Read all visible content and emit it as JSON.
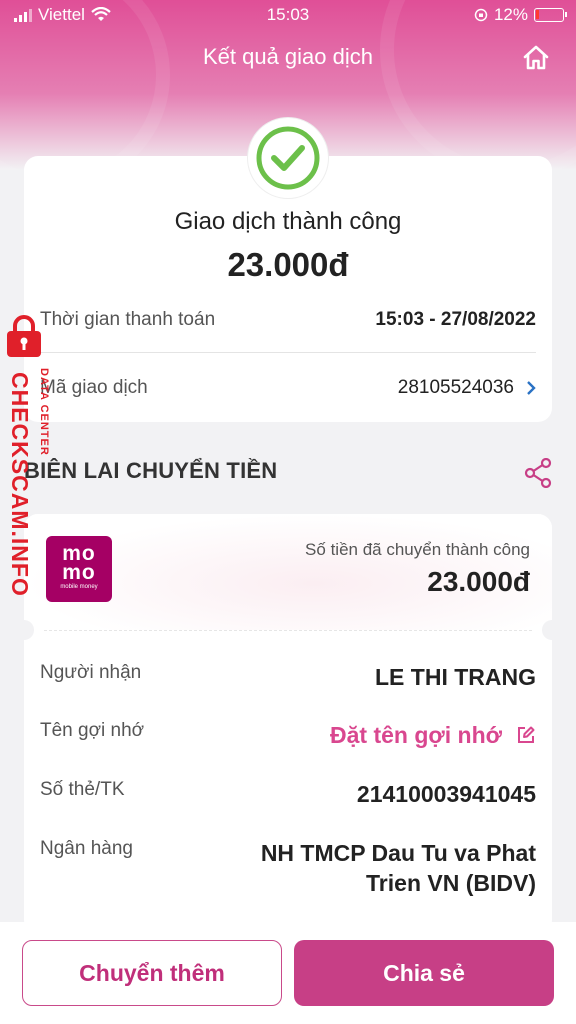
{
  "status_bar": {
    "carrier": "Viettel",
    "time": "15:03",
    "battery": "12%",
    "battery_level": 0.12
  },
  "header": {
    "title": "Kết quả giao dịch",
    "home_icon": "home-icon"
  },
  "result": {
    "status": "Giao dịch thành công",
    "amount": "23.000đ",
    "payment_time_label": "Thời gian thanh toán",
    "payment_time_value": "15:03 - 27/08/2022",
    "transaction_id_label": "Mã giao dịch",
    "transaction_id_value": "28105524036"
  },
  "receipt": {
    "title": "BIÊN LAI CHUYỂN TIỀN",
    "logo": {
      "line1": "mo",
      "line2": "mo",
      "tagline": "mobile money"
    },
    "sent_label": "Số tiền đã chuyển thành công",
    "sent_amount": "23.000đ",
    "rows": [
      {
        "label": "Người nhận",
        "value": "LE THI TRANG"
      },
      {
        "label": "Tên gợi nhớ",
        "value": "Đặt tên gợi nhớ"
      },
      {
        "label": "Số thẻ/TK",
        "value": "21410003941045"
      },
      {
        "label": "Ngân hàng",
        "value": "NH TMCP Dau Tu va Phat",
        "value2": "Trien VN (BIDV)"
      }
    ]
  },
  "actions": {
    "transfer_more": "Chuyển thêm",
    "share": "Chia sẻ"
  },
  "watermark": {
    "main": "CHECKSCAM.INFO",
    "sub": "DATA CENTER"
  },
  "colors": {
    "brand": "#c73f86",
    "link": "#2a72c4",
    "success": "#6cc04a",
    "watermark": "#e0202a"
  }
}
